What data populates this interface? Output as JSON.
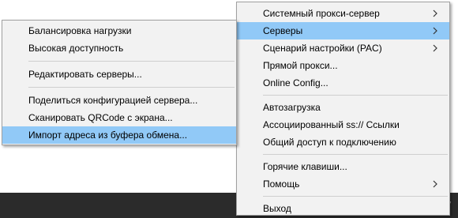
{
  "main_menu": {
    "items": [
      {
        "label": "Системный прокси-сервер",
        "submenu": true
      },
      {
        "label": "Серверы",
        "submenu": true,
        "highlighted": true
      },
      {
        "label": "Сценарий настройки (PAC)",
        "submenu": true
      },
      {
        "label": "Прямой прокси..."
      },
      {
        "label": "Online Config..."
      },
      {
        "label": "Автозагрузка"
      },
      {
        "label": "Ассоциированный ss:// Ссылки"
      },
      {
        "label": "Общий доступ к подключению"
      },
      {
        "label": "Горячие клавиши..."
      },
      {
        "label": "Помощь",
        "submenu": true
      },
      {
        "label": "Выход"
      }
    ]
  },
  "servers_submenu": {
    "items": [
      {
        "label": "Балансировка нагрузки"
      },
      {
        "label": "Высокая доступность"
      },
      {
        "label": "Редактировать серверы..."
      },
      {
        "label": "Поделиться конфигурацией сервера..."
      },
      {
        "label": "Сканировать QRCode с экрана..."
      },
      {
        "label": "Импорт адреса из буфера обмена...",
        "highlighted": true
      }
    ]
  },
  "taskbar": {
    "tray_icon": "send-arrow-icon"
  },
  "colors": {
    "highlight": "#91c9f7",
    "menu_bg": "#f2f2f2",
    "taskbar": "#2b2b2b"
  }
}
